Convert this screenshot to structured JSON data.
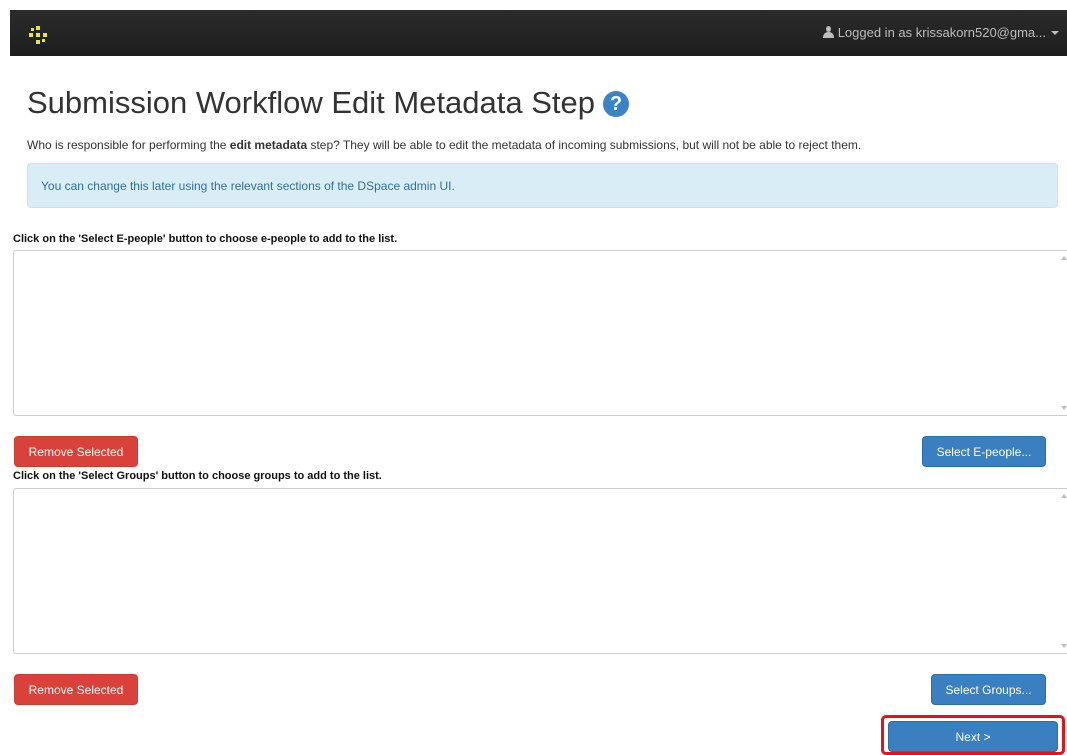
{
  "navbar": {
    "logo_icon": "dspace-logo-icon",
    "user_text": "Logged in as krissakorn520@gma...",
    "user_icon": "user-icon",
    "dropdown_icon": "caret-down-icon"
  },
  "page": {
    "title": "Submission Workflow Edit Metadata Step",
    "help_icon": "?",
    "lead_prefix": "Who is responsible for performing the ",
    "lead_bold": "edit metadata",
    "lead_suffix": " step? They will be able to edit the metadata of incoming submissions, but will not be able to reject them.",
    "alert": "You can change this later using the relevant sections of the DSpace admin UI."
  },
  "epeople": {
    "instruction": "Click on the 'Select E-people' button to choose e-people to add to the list.",
    "remove_label": "Remove Selected",
    "select_label": "Select E-people..."
  },
  "groups": {
    "instruction": "Click on the 'Select Groups' button to choose groups to add to the list.",
    "remove_label": "Remove Selected",
    "select_label": "Select Groups..."
  },
  "next_label": "Next >",
  "colors": {
    "navbar": "#222222",
    "danger": "#d9413b",
    "primary": "#3a7fc0",
    "alert_bg": "#d9edf7",
    "alert_text": "#31708f",
    "highlight": "#e0141d"
  }
}
